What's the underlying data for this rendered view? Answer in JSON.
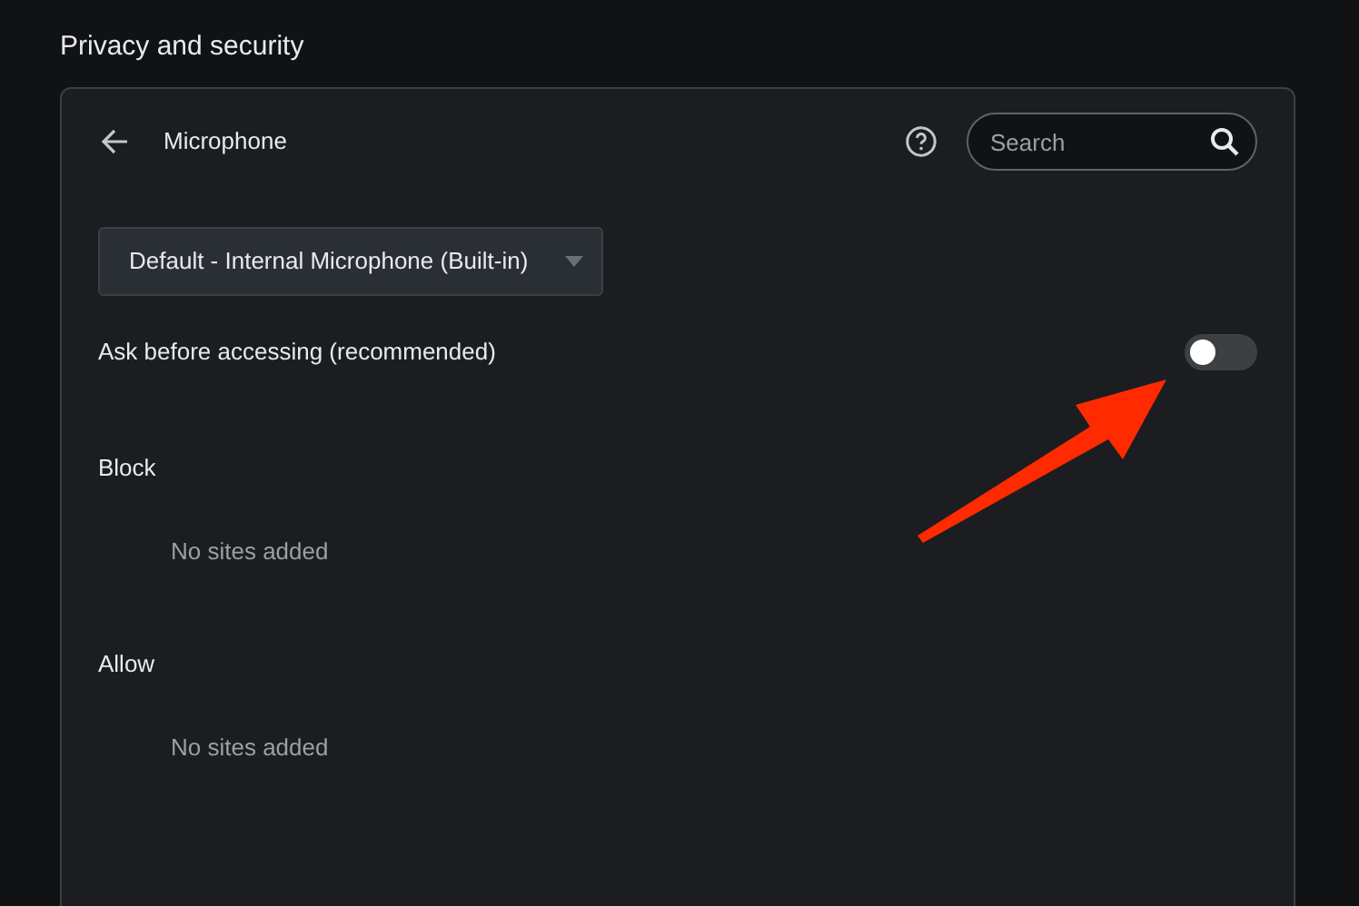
{
  "page_title": "Privacy and security",
  "header": {
    "title": "Microphone",
    "search": {
      "placeholder": "Search"
    }
  },
  "device_select": {
    "value": "Default - Internal Microphone (Built-in)"
  },
  "ask_setting": {
    "label": "Ask before accessing (recommended)",
    "on": false
  },
  "sections": [
    {
      "title": "Block",
      "empty_text": "No sites added"
    },
    {
      "title": "Allow",
      "empty_text": "No sites added"
    }
  ],
  "annotation": {
    "kind": "arrow"
  }
}
